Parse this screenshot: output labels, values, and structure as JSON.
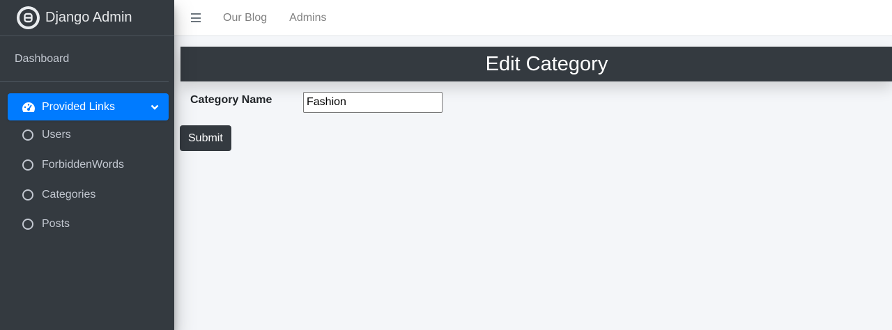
{
  "brand": {
    "title": "Django Admin",
    "logo_icon": "django-logo-icon"
  },
  "sidebar": {
    "dashboard_label": "Dashboard",
    "active_item": {
      "label": "Provided Links",
      "icon": "tachometer-icon",
      "chevron": "chevron-down-icon",
      "color": "#007bff"
    },
    "items": [
      {
        "label": "Users",
        "icon": "circle-icon"
      },
      {
        "label": "ForbiddenWords",
        "icon": "circle-icon"
      },
      {
        "label": "Categories",
        "icon": "circle-icon"
      },
      {
        "label": "Posts",
        "icon": "circle-icon"
      }
    ]
  },
  "topbar": {
    "menu_icon": "hamburger-icon",
    "links": [
      "Our Blog",
      "Admins"
    ]
  },
  "main": {
    "page_title": "Edit Category",
    "form": {
      "field_label": "Category Name",
      "field_value": "Fashion",
      "submit_label": "Submit"
    }
  }
}
